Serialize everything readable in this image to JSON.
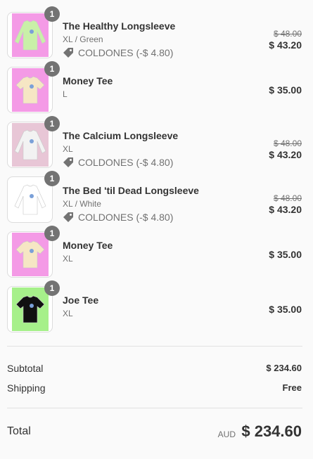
{
  "cart": {
    "items": [
      {
        "quantity": "1",
        "name": "The Healthy Longsleeve",
        "variant": "XL / Green",
        "discount": "COLDONES (-$ 4.80)",
        "original_price": "$ 48.00",
        "price": "$ 43.20",
        "thumb_bg": "#f49ae6",
        "shirt_color": "#c9f0a8"
      },
      {
        "quantity": "1",
        "name": "Money Tee",
        "variant": "L",
        "price": "$ 35.00",
        "thumb_bg": "#f49ae6",
        "shirt_color": "#f6e6c4"
      },
      {
        "quantity": "1",
        "name": "The Calcium Longsleeve",
        "variant": "XL",
        "discount": "COLDONES (-$ 4.80)",
        "original_price": "$ 48.00",
        "price": "$ 43.20",
        "thumb_bg": "#e8c6d6",
        "shirt_color": "#f2f2f2"
      },
      {
        "quantity": "1",
        "name": "The Bed 'til Dead Longsleeve",
        "variant": "XL / White",
        "discount": "COLDONES (-$ 4.80)",
        "original_price": "$ 48.00",
        "price": "$ 43.20",
        "thumb_bg": "#ffffff",
        "shirt_color": "#ffffff"
      },
      {
        "quantity": "1",
        "name": "Money Tee",
        "variant": "XL",
        "price": "$ 35.00",
        "thumb_bg": "#f49ae6",
        "shirt_color": "#f6e6c4"
      },
      {
        "quantity": "1",
        "name": "Joe Tee",
        "variant": "XL",
        "price": "$ 35.00",
        "thumb_bg": "#a6f08a",
        "shirt_color": "#111111"
      }
    ]
  },
  "summary": {
    "subtotal_label": "Subtotal",
    "subtotal_value": "$ 234.60",
    "shipping_label": "Shipping",
    "shipping_value": "Free",
    "total_label": "Total",
    "currency": "AUD",
    "total_value": "$ 234.60"
  },
  "icons": {
    "discount": "tag-icon",
    "product": "tshirt-thumbnail"
  }
}
